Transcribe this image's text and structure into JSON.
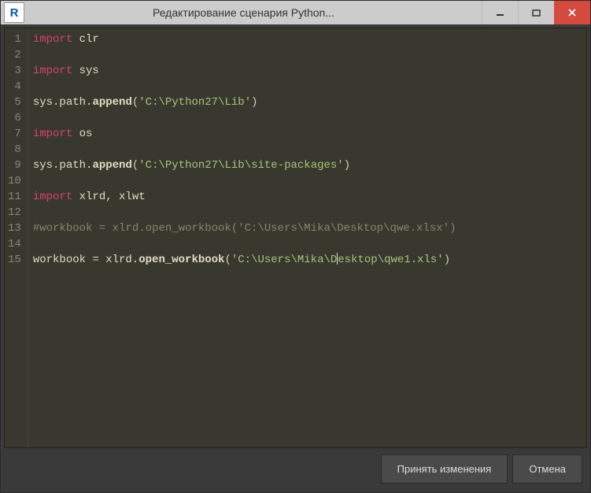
{
  "window": {
    "title": "Редактирование сценария Python...",
    "app_letter": "R"
  },
  "code": {
    "lines": [
      {
        "n": 1,
        "tokens": [
          {
            "t": "import ",
            "c": "kw"
          },
          {
            "t": "clr",
            "c": "id"
          }
        ]
      },
      {
        "n": 2,
        "tokens": []
      },
      {
        "n": 3,
        "tokens": [
          {
            "t": "import ",
            "c": "kw"
          },
          {
            "t": "sys",
            "c": "id"
          }
        ]
      },
      {
        "n": 4,
        "tokens": []
      },
      {
        "n": 5,
        "tokens": [
          {
            "t": "sys.path.",
            "c": "id"
          },
          {
            "t": "append",
            "c": "fn"
          },
          {
            "t": "(",
            "c": "punc"
          },
          {
            "t": "'C:\\Python27\\Lib'",
            "c": "str"
          },
          {
            "t": ")",
            "c": "punc"
          }
        ]
      },
      {
        "n": 6,
        "tokens": []
      },
      {
        "n": 7,
        "tokens": [
          {
            "t": "import ",
            "c": "kw"
          },
          {
            "t": "os",
            "c": "id"
          }
        ]
      },
      {
        "n": 8,
        "tokens": []
      },
      {
        "n": 9,
        "tokens": [
          {
            "t": "sys.path.",
            "c": "id"
          },
          {
            "t": "append",
            "c": "fn"
          },
          {
            "t": "(",
            "c": "punc"
          },
          {
            "t": "'C:\\Python27\\Lib\\site-packages'",
            "c": "str"
          },
          {
            "t": ")",
            "c": "punc"
          }
        ]
      },
      {
        "n": 10,
        "tokens": []
      },
      {
        "n": 11,
        "tokens": [
          {
            "t": "import ",
            "c": "kw"
          },
          {
            "t": "xlrd, xlwt",
            "c": "id"
          }
        ]
      },
      {
        "n": 12,
        "tokens": []
      },
      {
        "n": 13,
        "tokens": [
          {
            "t": "#workbook = xlrd.open_workbook('C:\\Users\\Mika\\Desktop\\qwe.xlsx')",
            "c": "cm"
          }
        ]
      },
      {
        "n": 14,
        "tokens": []
      },
      {
        "n": 15,
        "tokens": [
          {
            "t": "workbook = xlrd.",
            "c": "id"
          },
          {
            "t": "open_workbook",
            "c": "fn"
          },
          {
            "t": "(",
            "c": "punc"
          },
          {
            "t": "'C:\\Users\\Mika\\D",
            "c": "str"
          },
          {
            "cursor": true
          },
          {
            "t": "esktop\\qwe1.xls'",
            "c": "str"
          },
          {
            "t": ")",
            "c": "punc"
          }
        ]
      }
    ]
  },
  "buttons": {
    "accept": "Принять изменения",
    "cancel": "Отмена"
  }
}
